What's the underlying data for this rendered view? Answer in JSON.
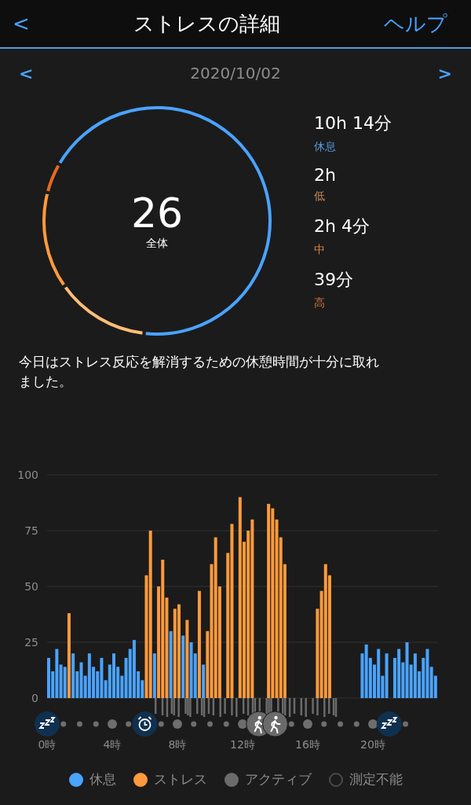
{
  "header": {
    "back": "<",
    "title": "ストレスの詳細",
    "help": "ヘルプ"
  },
  "date_nav": {
    "prev": "<",
    "date": "2020/10/02",
    "next": ">"
  },
  "summary": {
    "score": "26",
    "score_label": "全体",
    "chart_data": {
      "type": "donut",
      "values": [
        68.5,
        13.4,
        13.8,
        4.3
      ],
      "colors": [
        "#4aa3ff",
        "#ffbe76",
        "#ff9a3c",
        "#e8691e"
      ]
    }
  },
  "stats": [
    {
      "value": "10h 14分",
      "label": "休息",
      "color": "#5b9be0"
    },
    {
      "value": "2h",
      "label": "低",
      "color": "#c98a5a"
    },
    {
      "value": "2h 4分",
      "label": "中",
      "color": "#d9884a"
    },
    {
      "value": "39分",
      "label": "高",
      "color": "#d9773a"
    }
  ],
  "message": "今日はストレス反応を解消するための休憩時間が十分に取れました。",
  "chart": {
    "chart_data": {
      "type": "bar",
      "grid": true,
      "ylim": [
        0,
        100
      ],
      "yticks": [
        0,
        25,
        50,
        75,
        100
      ],
      "xlim": [
        0,
        24
      ],
      "xticks": [
        {
          "value": 0,
          "label": "0時"
        },
        {
          "value": 4,
          "label": "4時"
        },
        {
          "value": 8,
          "label": "8時"
        },
        {
          "value": 12,
          "label": "12時"
        },
        {
          "value": 16,
          "label": "16時"
        },
        {
          "value": 20,
          "label": "20時"
        }
      ],
      "x": [
        0,
        0.25,
        0.5,
        0.75,
        1,
        1.25,
        1.5,
        1.75,
        2,
        2.25,
        2.5,
        2.75,
        3,
        3.25,
        3.5,
        3.75,
        4,
        4.25,
        4.5,
        4.75,
        5,
        5.25,
        5.5,
        5.75,
        6,
        6.25,
        6.5,
        6.75,
        7,
        7.25,
        7.5,
        7.75,
        8,
        8.25,
        8.5,
        8.75,
        9,
        9.25,
        9.5,
        9.75,
        10,
        10.25,
        10.5,
        10.75,
        11,
        11.25,
        11.5,
        11.75,
        12,
        12.25,
        12.5,
        12.75,
        13,
        13.25,
        13.5,
        13.75,
        14,
        14.25,
        14.5,
        14.75,
        15,
        15.25,
        15.5,
        15.75,
        16,
        16.25,
        16.5,
        16.75,
        17,
        17.25,
        17.5,
        17.75,
        18,
        18.25,
        18.5,
        18.75,
        19,
        19.25,
        19.5,
        19.75,
        20,
        20.25,
        20.5,
        20.75,
        21,
        21.25,
        21.5,
        21.75,
        22,
        22.25,
        22.5,
        22.75,
        23,
        23.25,
        23.5,
        23.75
      ],
      "series": [
        {
          "color": "#4aa3ff",
          "values": [
            18,
            12,
            22,
            15,
            14,
            null,
            20,
            12,
            16,
            10,
            20,
            14,
            12,
            18,
            8,
            15,
            20,
            14,
            10,
            18,
            22,
            26,
            12,
            8,
            null,
            null,
            20,
            null,
            null,
            null,
            30,
            null,
            null,
            28,
            null,
            25,
            20,
            null,
            15,
            null,
            null,
            null,
            null,
            null,
            null,
            null,
            null,
            null,
            null,
            null,
            null,
            null,
            null,
            null,
            null,
            null,
            null,
            null,
            null,
            null,
            null,
            null,
            null,
            null,
            null,
            null,
            null,
            null,
            null,
            null,
            null,
            null,
            null,
            null,
            null,
            null,
            null,
            20,
            24,
            18,
            15,
            22,
            10,
            20,
            null,
            18,
            22,
            16,
            25,
            15,
            20,
            12,
            18,
            22,
            14,
            10
          ]
        },
        {
          "color": "#ff9a3c",
          "values": [
            null,
            null,
            null,
            null,
            null,
            38,
            null,
            null,
            null,
            null,
            null,
            null,
            null,
            null,
            null,
            null,
            null,
            null,
            null,
            null,
            null,
            null,
            null,
            null,
            55,
            75,
            null,
            50,
            62,
            45,
            null,
            40,
            42,
            null,
            35,
            null,
            null,
            48,
            null,
            30,
            60,
            72,
            50,
            null,
            65,
            78,
            null,
            90,
            70,
            75,
            80,
            null,
            null,
            null,
            87,
            85,
            80,
            72,
            60,
            null,
            null,
            null,
            null,
            null,
            null,
            null,
            40,
            48,
            60,
            55,
            null,
            null,
            null,
            null,
            null,
            null,
            null,
            null,
            null,
            null,
            null,
            null,
            null,
            null,
            null,
            null,
            null,
            null,
            null,
            null,
            null,
            null,
            null,
            null,
            null,
            null
          ]
        }
      ]
    },
    "timeline": [
      {
        "kind": "sleep"
      },
      {
        "kind": "dot"
      },
      {
        "kind": "dot"
      },
      {
        "kind": "dot"
      },
      {
        "kind": "big-dot"
      },
      {
        "kind": "dot"
      },
      {
        "kind": "alarm"
      },
      {
        "kind": "dot"
      },
      {
        "kind": "big-dot"
      },
      {
        "kind": "dot"
      },
      {
        "kind": "dot"
      },
      {
        "kind": "dot"
      },
      {
        "kind": "big-dot"
      },
      {
        "kind": "walk"
      },
      {
        "kind": "walk"
      },
      {
        "kind": "dot"
      },
      {
        "kind": "big-dot"
      },
      {
        "kind": "dot"
      },
      {
        "kind": "dot"
      },
      {
        "kind": "dot"
      },
      {
        "kind": "big-dot"
      },
      {
        "kind": "sleep"
      },
      {
        "kind": "dot"
      }
    ]
  },
  "legend": [
    {
      "label": "休息",
      "color": "#4aa3ff",
      "kind": "filled"
    },
    {
      "label": "ストレス",
      "color": "#ff9a3c",
      "kind": "filled"
    },
    {
      "label": "アクティブ",
      "color": "#6b6b6b",
      "kind": "filled"
    },
    {
      "label": "測定不能",
      "color": "#4a4a4a",
      "kind": "outline"
    }
  ]
}
